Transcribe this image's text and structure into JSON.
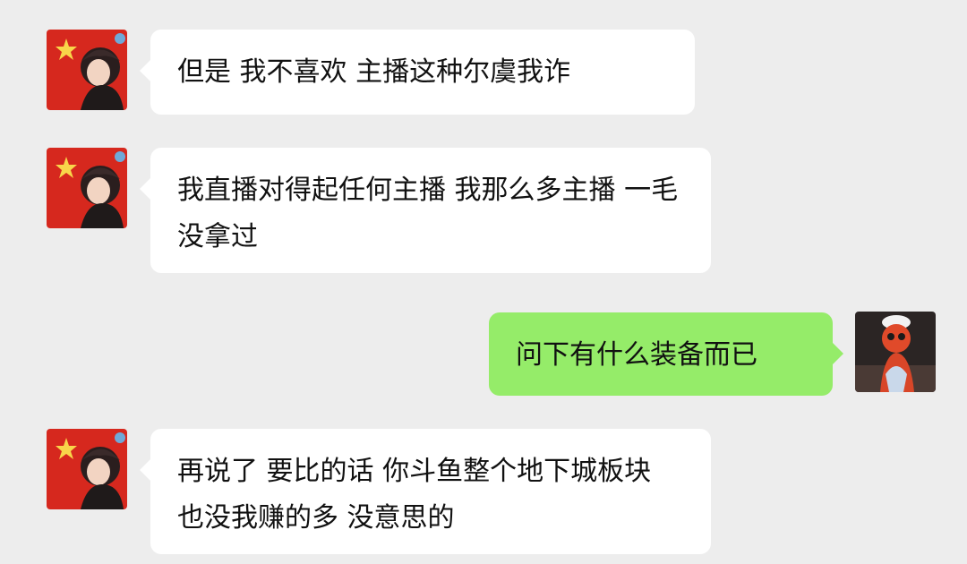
{
  "messages": [
    {
      "sender": "other",
      "avatar": "flag-girl-avatar",
      "text": "但是 我不喜欢 主播这种尔虞我诈"
    },
    {
      "sender": "other",
      "avatar": "flag-girl-avatar",
      "text": "我直播对得起任何主播  我那么多主播 一毛没拿过"
    },
    {
      "sender": "self",
      "avatar": "red-figure-avatar",
      "text": "问下有什么装备而已"
    },
    {
      "sender": "other",
      "avatar": "flag-girl-avatar",
      "text": "再说了 要比的话 你斗鱼整个地下城板块 也没我赚的多  没意思的"
    }
  ],
  "colors": {
    "background": "#ededed",
    "incoming_bubble": "#ffffff",
    "outgoing_bubble": "#95ec69"
  }
}
